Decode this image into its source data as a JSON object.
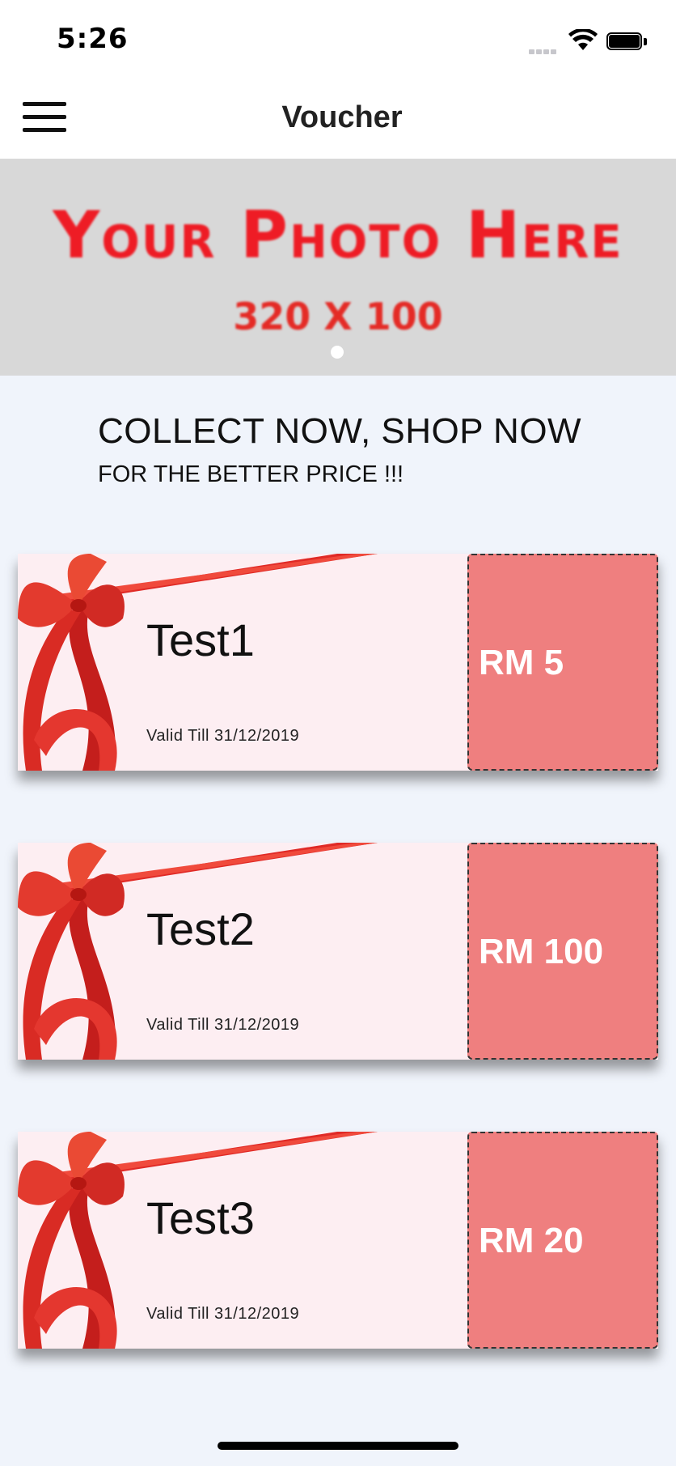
{
  "status_bar": {
    "time": "5:26"
  },
  "nav": {
    "title": "Voucher"
  },
  "banner": {
    "title": "Your Photo Here",
    "size": "320 X 100"
  },
  "promo": {
    "headline": "COLLECT NOW, SHOP NOW",
    "subheadline": "FOR THE BETTER PRICE !!!"
  },
  "vouchers": [
    {
      "name": "Test1",
      "valid": "Valid Till 31/12/2019",
      "amount": "RM 5"
    },
    {
      "name": "Test2",
      "valid": "Valid Till 31/12/2019",
      "amount": "RM 100"
    },
    {
      "name": "Test3",
      "valid": "Valid Till 31/12/2019",
      "amount": "RM 20"
    }
  ],
  "colors": {
    "background": "#f0f4fb",
    "voucher_bg": "#fdeef2",
    "amount_bg": "#ef7f7f",
    "ribbon": "#d9231f",
    "banner_text": "#ee1c25"
  },
  "icons": {
    "menu": "hamburger-menu-icon",
    "wifi": "wifi-icon",
    "battery": "battery-icon",
    "signal": "cellular-signal-icon"
  }
}
